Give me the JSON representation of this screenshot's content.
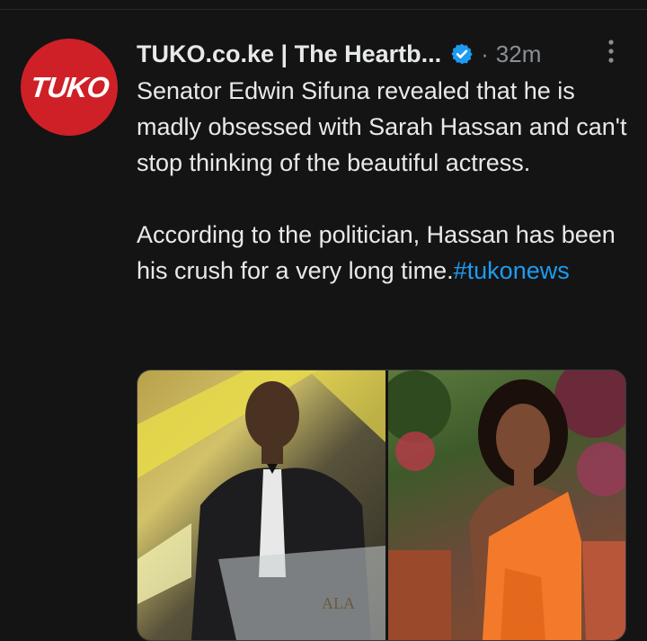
{
  "tweet": {
    "avatar_text": "TUKO",
    "author": "TUKO.co.ke | The Heartb...",
    "separator": "·",
    "timestamp": "32m",
    "text_p1": "Senator Edwin Sifuna revealed that he is madly obsessed with Sarah Hassan and can't stop thinking of the beautiful actress.",
    "text_p2": "According to the politician, Hassan has been his crush for a very long time.",
    "hashtag": "#tukonews",
    "photo_right_sign": "ALA"
  },
  "colors": {
    "background": "#141414",
    "avatar": "#cf2027",
    "verified": "#1d9bf0",
    "hashtag": "#1d9bf0",
    "muted": "#8b8f94"
  },
  "icons": {
    "verified": "verified-badge-icon",
    "more": "more-vertical-icon"
  }
}
